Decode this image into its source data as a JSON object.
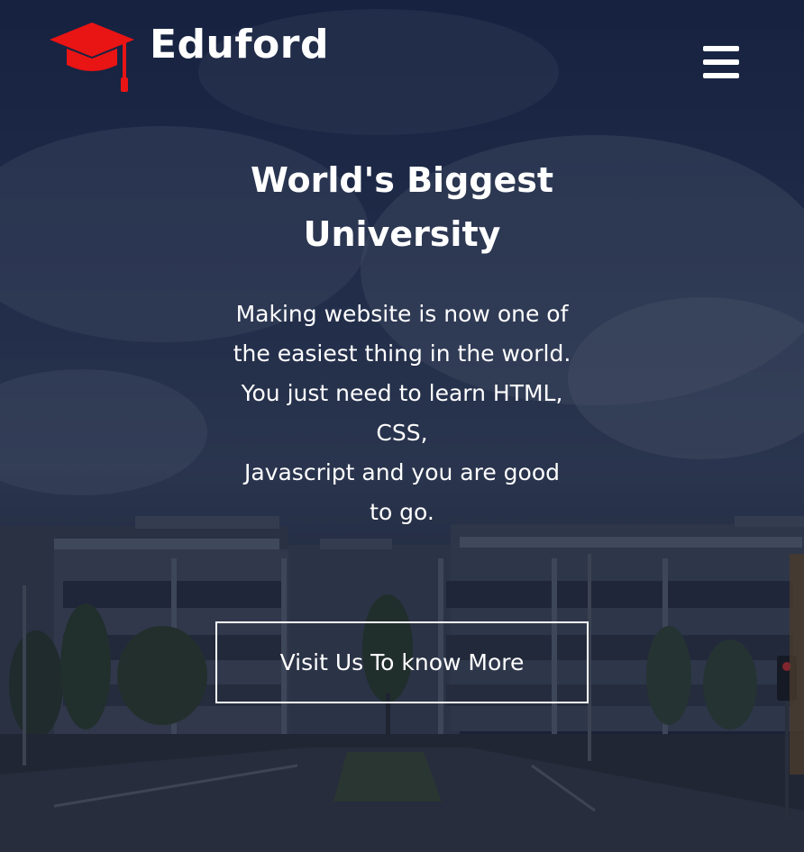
{
  "header": {
    "brand": "Eduford",
    "logo_icon": "graduation-cap-icon",
    "logo_color": "#e91414",
    "menu_icon": "hamburger-menu-icon"
  },
  "hero": {
    "title": "World's Biggest University",
    "description_lines": [
      "Making website is now one of",
      "the easiest thing in the world.",
      "You just need to learn HTML,",
      "CSS,",
      "Javascript and you are good",
      "to go."
    ],
    "cta_label": "Visit Us To know More",
    "background_image": "university-building-photo"
  }
}
